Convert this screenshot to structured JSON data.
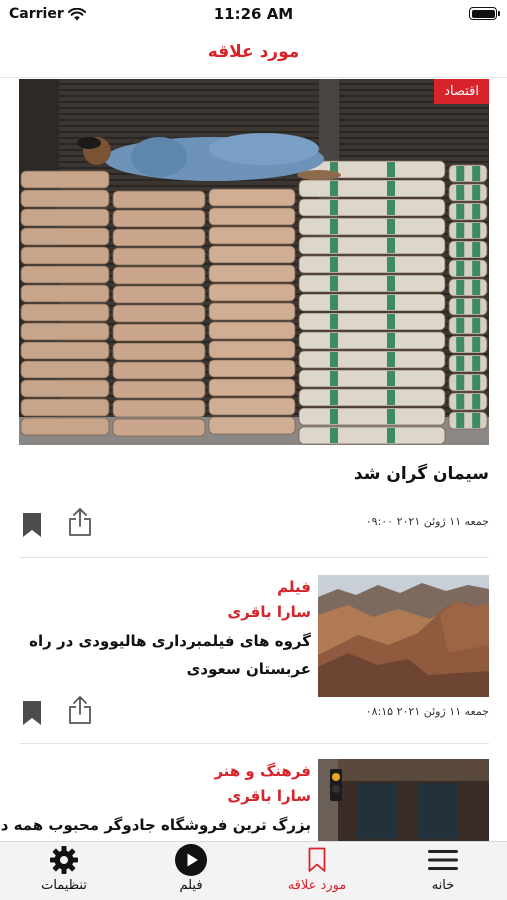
{
  "status_bar": {
    "carrier": "Carrier",
    "time": "11:26 AM"
  },
  "nav": {
    "title": "مورد علاقه"
  },
  "hero": {
    "badge": "اقتصاد",
    "title": "سیمان گران شد",
    "date": "جمعه ۱۱ ژوئن ۲۰۲۱ ۰۹:۰۰"
  },
  "articles": [
    {
      "category": "فیلم",
      "author": "سارا باقری",
      "headline": "گروه های فیلمبرداری هالیوودی در راه عربستان سعودی",
      "date": "جمعه ۱۱ ژوئن ۲۰۲۱ ۰۸:۱۵"
    },
    {
      "category": "فرهنگ و هنر",
      "author": "سارا باقری",
      "headline": "بزرگ ترین فروشگاه جادوگر محبوب همه در"
    }
  ],
  "tabs": [
    {
      "label": "خانه",
      "icon": "menu-icon"
    },
    {
      "label": "مورد علاقه",
      "icon": "bookmark-icon"
    },
    {
      "label": "فیلم",
      "icon": "play-icon"
    },
    {
      "label": "تنظیمات",
      "icon": "gear-icon"
    }
  ],
  "colors": {
    "accent": "#d8232a",
    "tab_bar": "#f3f3f3"
  }
}
